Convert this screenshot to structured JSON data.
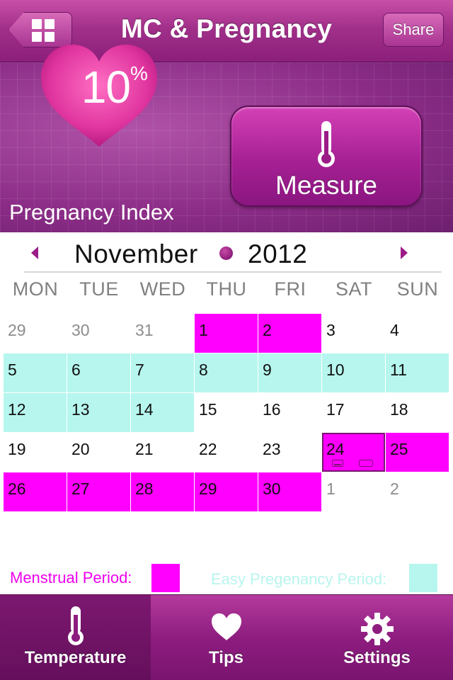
{
  "header": {
    "title": "MC & Pregnancy",
    "menu_icon": "grid-icon",
    "share_label": "Share"
  },
  "hero": {
    "pregnancy_index_value": "10",
    "pregnancy_index_unit": "%",
    "pregnancy_index_label": "Pregnancy Index",
    "measure_label": "Measure",
    "measure_icon": "thermometer-icon"
  },
  "calendar": {
    "month": "November",
    "year": "2012",
    "weekdays": [
      "MON",
      "TUE",
      "WED",
      "THU",
      "FRI",
      "SAT",
      "SUN"
    ],
    "weeks": [
      [
        {
          "day": "29",
          "state": "muted"
        },
        {
          "day": "30",
          "state": "muted"
        },
        {
          "day": "31",
          "state": "muted"
        },
        {
          "day": "1",
          "state": "menstrual"
        },
        {
          "day": "2",
          "state": "menstrual"
        },
        {
          "day": "3",
          "state": "normal"
        },
        {
          "day": "4",
          "state": "normal"
        }
      ],
      [
        {
          "day": "5",
          "state": "fertile"
        },
        {
          "day": "6",
          "state": "fertile"
        },
        {
          "day": "7",
          "state": "fertile"
        },
        {
          "day": "8",
          "state": "fertile"
        },
        {
          "day": "9",
          "state": "fertile"
        },
        {
          "day": "10",
          "state": "fertile"
        },
        {
          "day": "11",
          "state": "fertile"
        }
      ],
      [
        {
          "day": "12",
          "state": "fertile"
        },
        {
          "day": "13",
          "state": "fertile"
        },
        {
          "day": "14",
          "state": "fertile"
        },
        {
          "day": "15",
          "state": "normal"
        },
        {
          "day": "16",
          "state": "normal"
        },
        {
          "day": "17",
          "state": "normal"
        },
        {
          "day": "18",
          "state": "normal"
        }
      ],
      [
        {
          "day": "19",
          "state": "normal"
        },
        {
          "day": "20",
          "state": "normal"
        },
        {
          "day": "21",
          "state": "normal"
        },
        {
          "day": "22",
          "state": "normal"
        },
        {
          "day": "23",
          "state": "normal"
        },
        {
          "day": "24",
          "state": "today-menstrual"
        },
        {
          "day": "25",
          "state": "menstrual"
        }
      ],
      [
        {
          "day": "26",
          "state": "menstrual"
        },
        {
          "day": "27",
          "state": "menstrual"
        },
        {
          "day": "28",
          "state": "menstrual"
        },
        {
          "day": "29",
          "state": "menstrual"
        },
        {
          "day": "30",
          "state": "menstrual"
        },
        {
          "day": "1",
          "state": "muted"
        },
        {
          "day": "2",
          "state": "muted"
        }
      ]
    ]
  },
  "legend": {
    "menstrual_label": "Menstrual Period:",
    "menstrual_color": "#ff00ff",
    "fertile_label": "Easy Pregenancy Period:",
    "fertile_color": "#b6f6ee"
  },
  "tabs": [
    {
      "label": "Temperature",
      "icon": "thermometer-icon",
      "active": true
    },
    {
      "label": "Tips",
      "icon": "heart-icon",
      "active": false
    },
    {
      "label": "Settings",
      "icon": "gear-icon",
      "active": false
    }
  ],
  "colors": {
    "brand_purple": "#8e1d80",
    "menstrual": "#ff00ff",
    "fertile": "#b6f6ee"
  }
}
